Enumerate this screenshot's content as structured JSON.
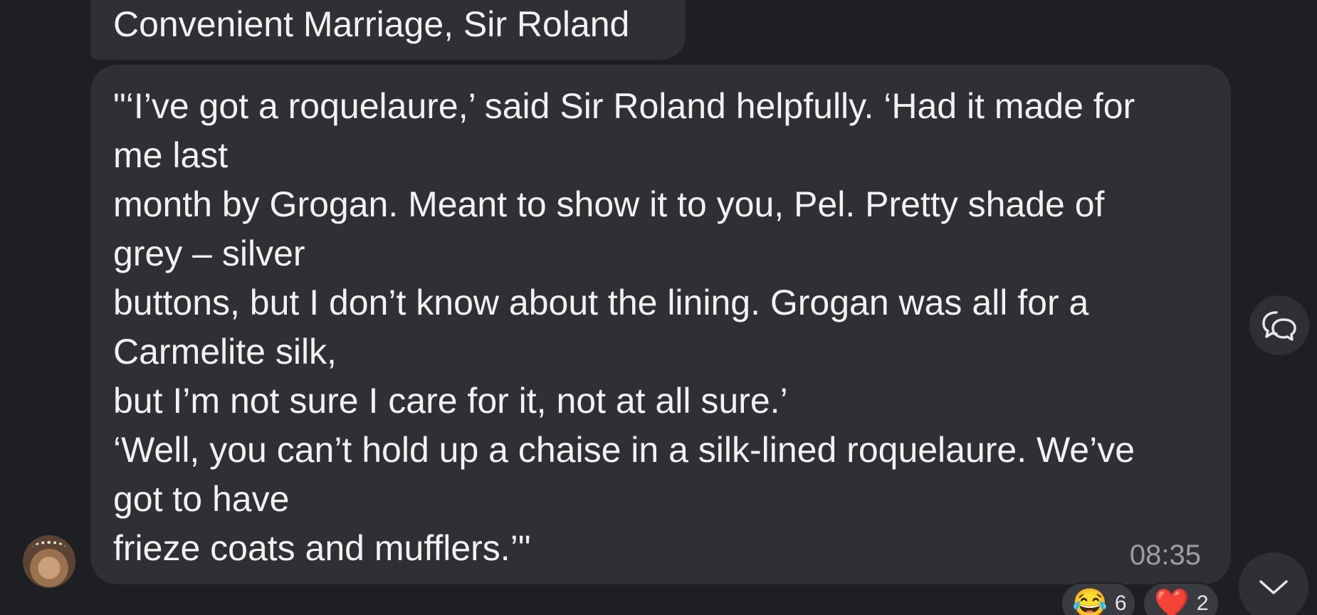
{
  "messages": {
    "previous_tail": "Convenient Marriage, Sir Roland",
    "main_lines": [
      "\"‘I’ve got a roquelaure,’ said Sir Roland helpfully. ‘Had it made for",
      "me last",
      "month by Grogan. Meant to show it to you, Pel. Pretty shade of",
      "grey – silver",
      "buttons, but I don’t know about the lining. Grogan was all for a",
      "Carmelite silk,",
      "but I’m not sure I care for it, not at all sure.’",
      "‘Well, you can’t hold up a chaise in a silk-lined roquelaure. We’ve",
      "got to have",
      "frieze coats and mufflers.’\""
    ],
    "time": "08:35"
  },
  "reactions": [
    {
      "emoji": "😂",
      "count": "6"
    },
    {
      "emoji": "❤️",
      "count": "2"
    }
  ],
  "icons": {
    "comment": "comment-icon",
    "scroll_down": "chevron-down-icon",
    "avatar": "cat-avatar"
  },
  "colors": {
    "background": "#1e1f23",
    "bubble": "#2f3034",
    "text": "#f2f2f3",
    "timestamp": "#9c9ea3"
  }
}
